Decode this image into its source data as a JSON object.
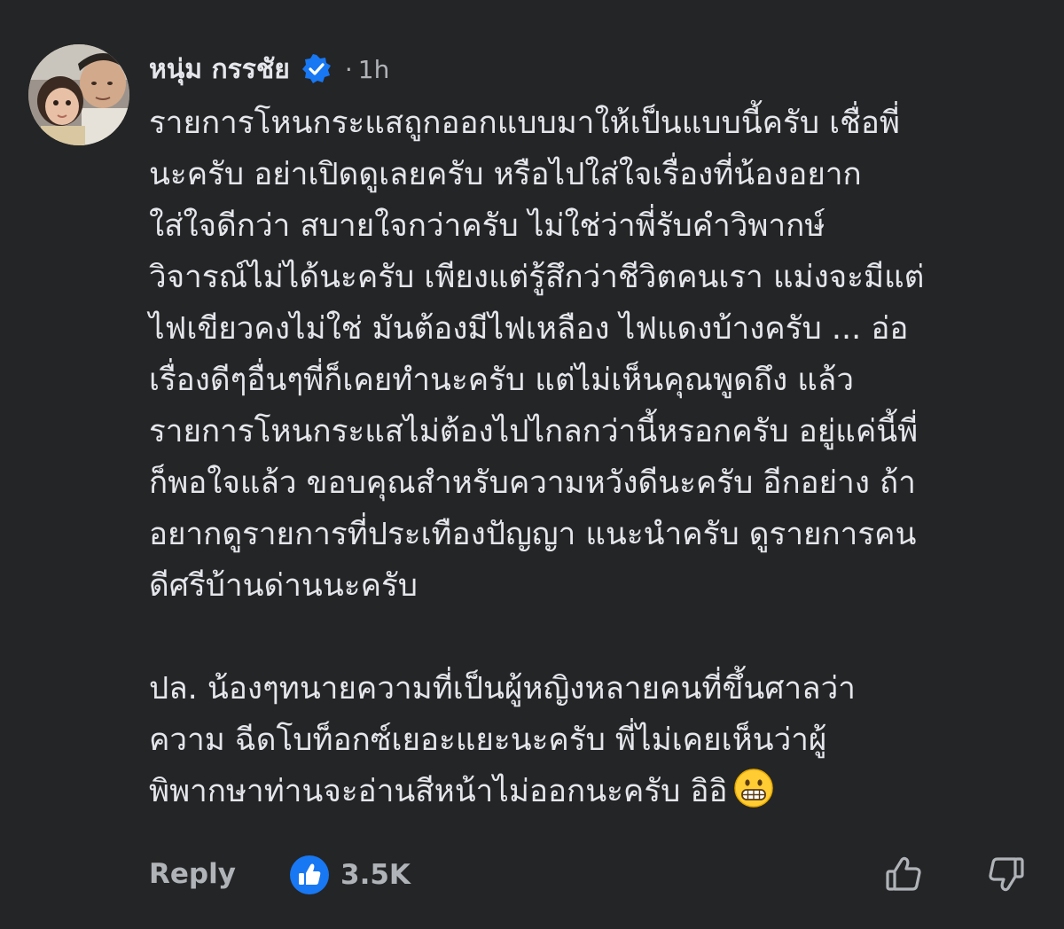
{
  "comment": {
    "author": "หนุ่ม กรรชัย",
    "verified": true,
    "separator": "·",
    "timestamp": "1h",
    "lines": [
      "รายการโหนกระแสถูกออกแบบมาให้เป็นแบบนี้ครับ  เชื่อพี่",
      "นะครับ อย่าเปิดดูเลยครับ หรือไปใส่ใจเรื่องที่น้องอยาก",
      "ใส่ใจดีกว่า สบายใจกว่าครับ  ไม่ใช่ว่าพี่รับคำวิพากษ์",
      "วิจารณ์ไม่ได้นะครับ เพียงแต่รู้สึกว่าชีวิตคนเรา แม่งจะมีแต่",
      "ไฟเขียวคงไม่ใช่ มันต้องมีไฟเหลือง ไฟแดงบ้างครับ ... อ่อ",
      "เรื่องดีๆอื่นๆพี่ก็เคยทำนะครับ แต่ไม่เห็นคุณพูดถึง แล้ว",
      "รายการโหนกระแสไม่ต้องไปไกลกว่านี้หรอกครับ อยู่แค่นี้พี่",
      "ก็พอใจแล้ว ขอบคุณสำหรับความหวังดีนะครับ อีกอย่าง ถ้า",
      "อยากดูรายการที่ประเทืองปัญญา แนะนำครับ ดูรายการคน",
      "ดีศรีบ้านด่านนะครับ"
    ],
    "ps_lines": [
      "ปล. น้องๆทนายความที่เป็นผู้หญิงหลายคนที่ขึ้นศาลว่า",
      "ความ  ฉีดโบท็อกซ์เยอะแยะนะครับ พี่ไม่เคยเห็นว่าผู้",
      "พิพากษาท่านจะอ่านสีหน้าไม่ออกนะครับ อิอิ"
    ],
    "emoji": "grimacing-face"
  },
  "footer": {
    "reply_label": "Reply",
    "reaction_type": "like",
    "reaction_count": "3.5K"
  },
  "colors": {
    "background": "#242526",
    "text_primary": "#e4e6eb",
    "text_secondary": "#b0b3b8",
    "accent_blue": "#1877f2"
  }
}
